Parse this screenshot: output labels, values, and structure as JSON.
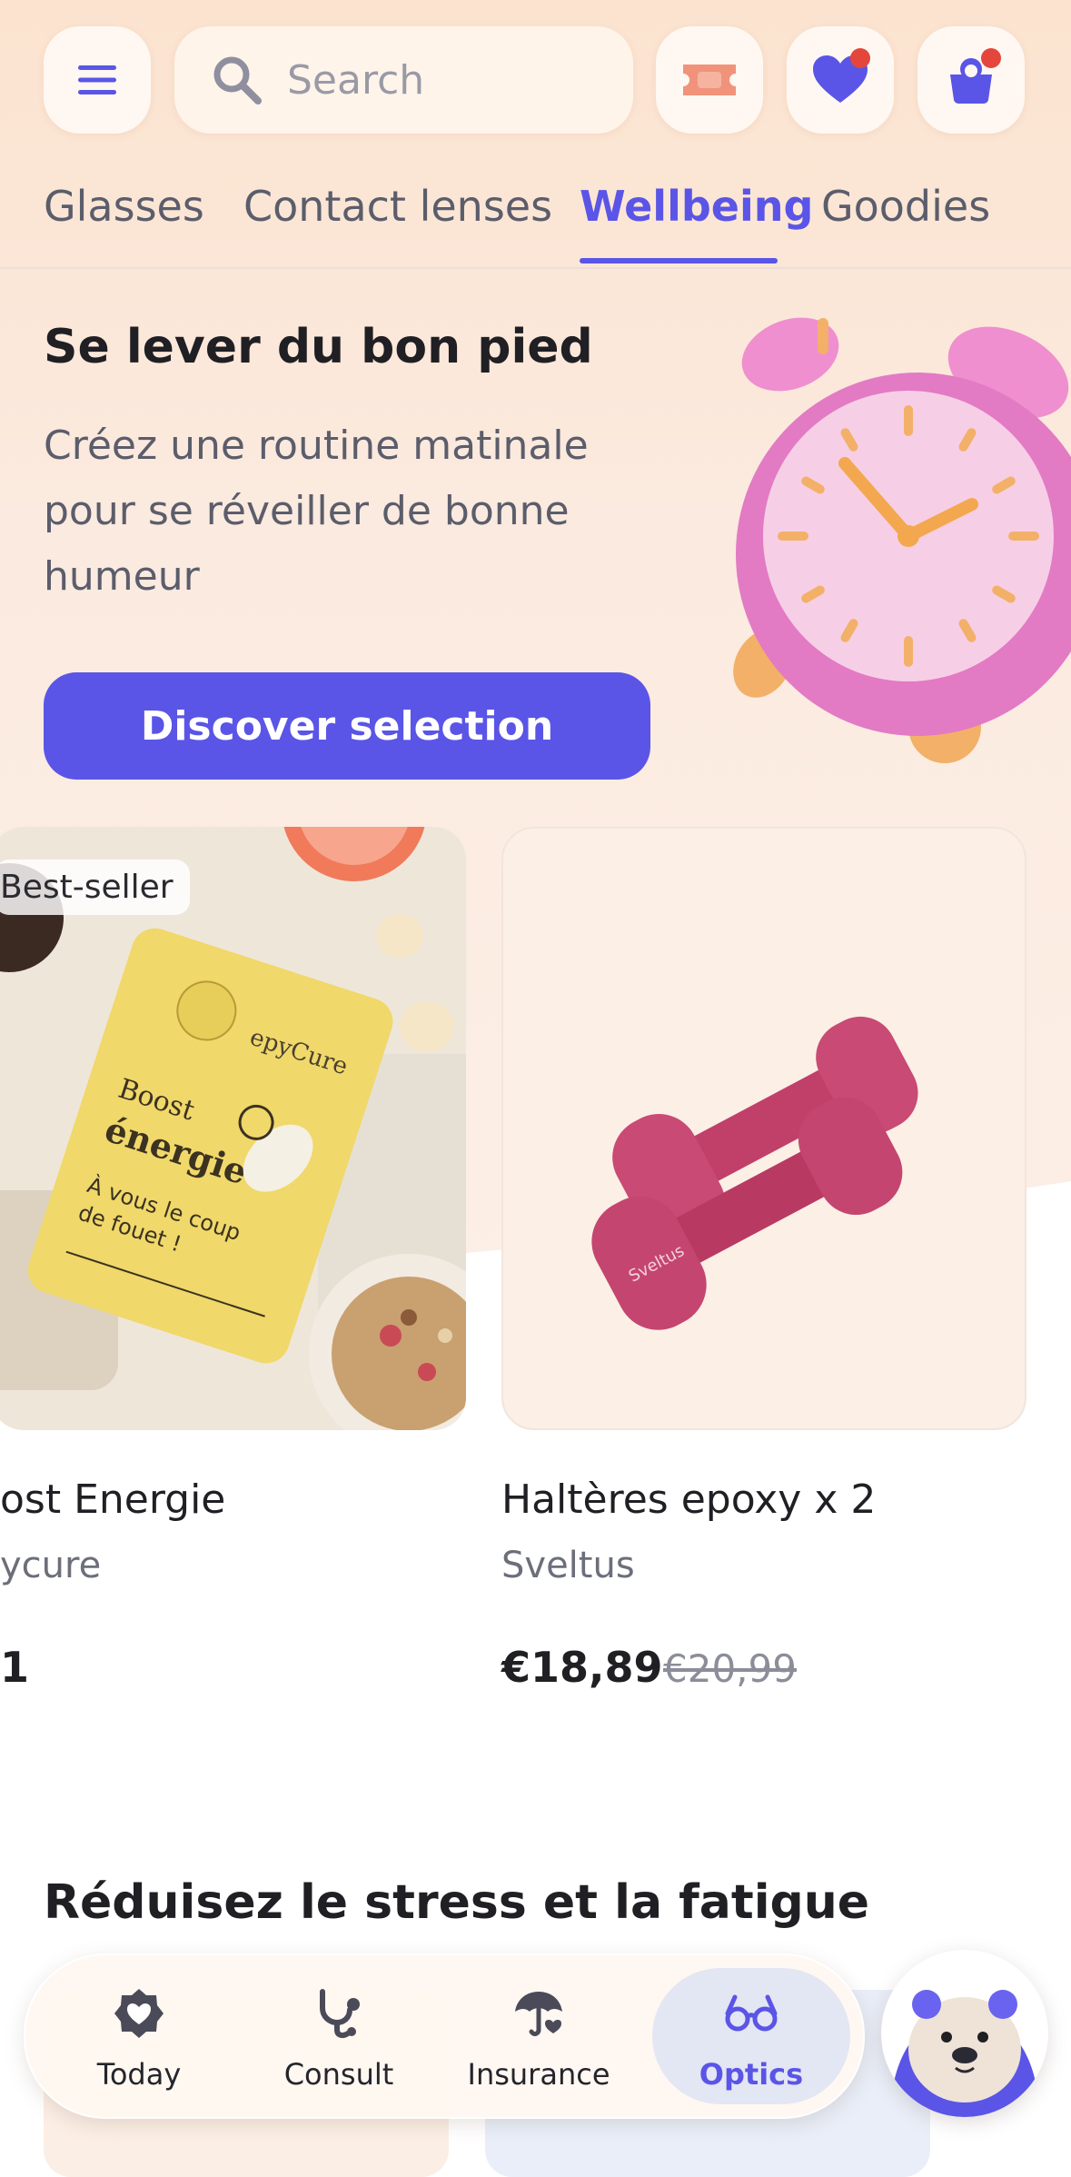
{
  "header": {
    "search_placeholder": "Search",
    "menu_icon": "hamburger-menu-icon",
    "coupon_icon": "ticket-icon",
    "favorites_icon": "heart-icon",
    "cart_icon": "shopping-bag-icon",
    "notification_color": "#e5463b"
  },
  "tabs": [
    {
      "label": "Glasses",
      "active": false
    },
    {
      "label": "Contact lenses",
      "active": false
    },
    {
      "label": "Wellbeing",
      "active": true
    },
    {
      "label": "Goodies",
      "active": false
    }
  ],
  "hero": {
    "title": "Se lever du bon pied",
    "subtitle": "Créez une routine matinale pour se réveiller de bonne humeur",
    "cta_label": "Discover selection",
    "illustration": "alarm-clock"
  },
  "products": [
    {
      "badge": "Best-seller",
      "name": "ost Energie",
      "brand": "ycure",
      "price": "1",
      "image": "epycure-boost-energie-pouch"
    },
    {
      "name": "Haltères epoxy x 2",
      "brand": "Sveltus",
      "price": "€18,89",
      "old_price": "€20,99",
      "image": "pink-dumbbells"
    }
  ],
  "section": {
    "title": "Réduisez le stress et la fatigue"
  },
  "bottom_nav": [
    {
      "label": "Today",
      "icon": "heart-badge-icon",
      "active": false
    },
    {
      "label": "Consult",
      "icon": "stethoscope-icon",
      "active": false
    },
    {
      "label": "Insurance",
      "icon": "umbrella-heart-icon",
      "active": false
    },
    {
      "label": "Optics",
      "icon": "glasses-icon",
      "active": true
    }
  ],
  "colors": {
    "accent": "#5a55e6",
    "background_top": "#fbe3cf",
    "text_primary": "#1f1f24",
    "text_secondary": "#5b5d6b",
    "notification": "#e5463b"
  }
}
